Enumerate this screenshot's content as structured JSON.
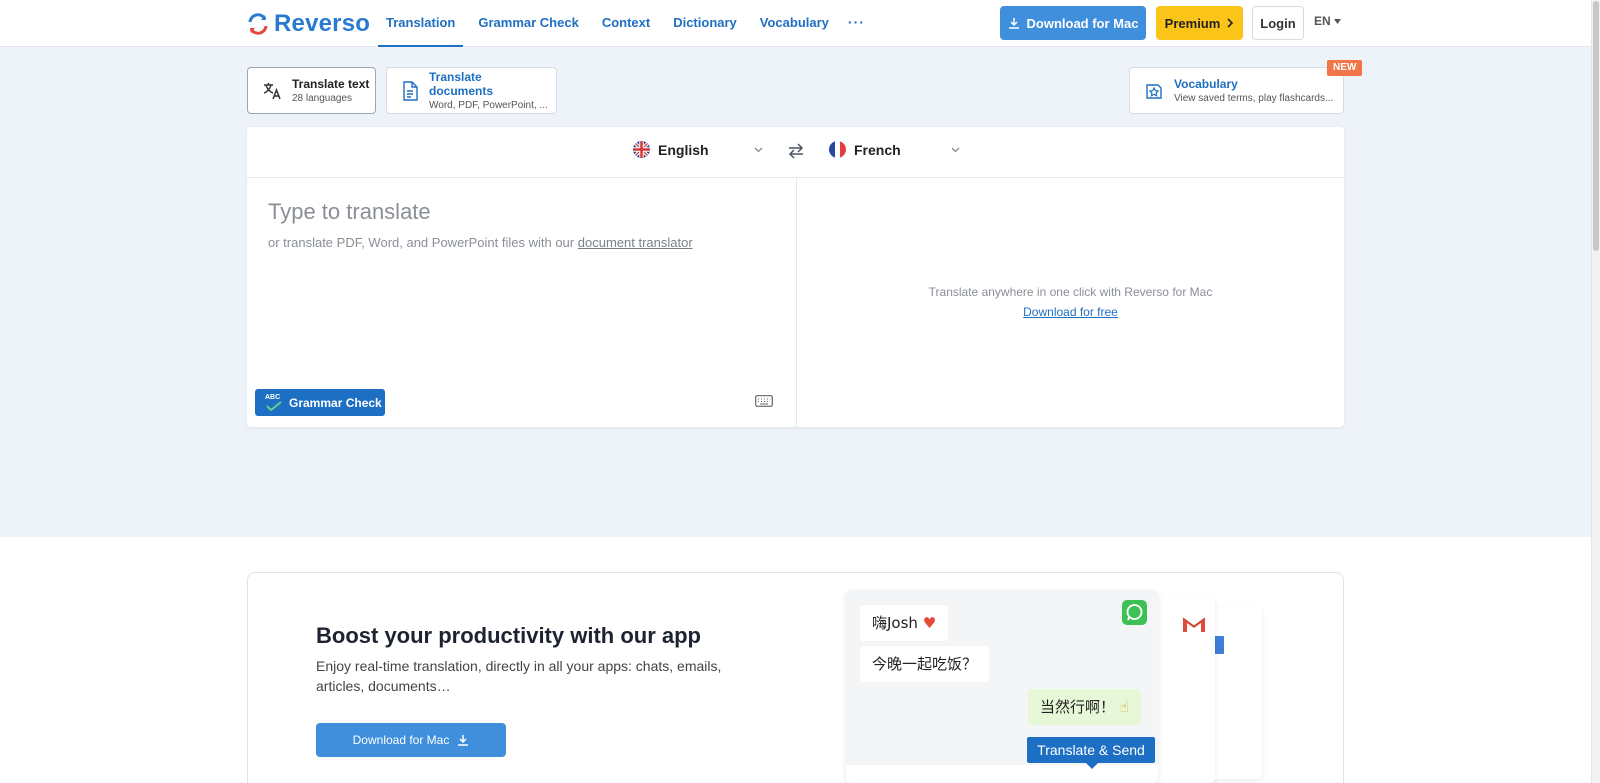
{
  "header": {
    "logo_text": "Reverso",
    "nav": [
      {
        "label": "Translation"
      },
      {
        "label": "Grammar Check"
      },
      {
        "label": "Context"
      },
      {
        "label": "Dictionary"
      },
      {
        "label": "Vocabulary"
      }
    ],
    "more_label": "···",
    "download_label": "Download for Mac",
    "premium_label": "Premium",
    "login_label": "Login",
    "lang_label": "EN"
  },
  "modes": {
    "text": {
      "title": "Translate text",
      "subtitle": "28 languages"
    },
    "docs": {
      "title": "Translate documents",
      "subtitle": "Word, PDF, PowerPoint, ..."
    },
    "vocab": {
      "title": "Vocabulary",
      "subtitle": "View saved terms, play flashcards...",
      "badge": "NEW"
    }
  },
  "translator": {
    "source_lang": "English",
    "target_lang": "French",
    "placeholder": "Type to translate",
    "hint_prefix": "or translate PDF, Word, and PowerPoint files with our",
    "hint_link": "document translator",
    "grammar_check_label": "Grammar Check",
    "abc_label": "ABC",
    "promo_text": "Translate anywhere in one click with Reverso for Mac",
    "promo_link": "Download for free"
  },
  "app_promo": {
    "heading": "Boost your productivity with our app",
    "description": "Enjoy real-time translation, directly in all your apps: chats, emails, articles, documents…",
    "download_label": "Download for Mac",
    "chat": {
      "msg1": "嗨Josh",
      "msg2": "今晚一起吃饭？",
      "msg3": "当然行啊！",
      "translate_send": "Translate & Send"
    }
  },
  "colors": {
    "brand_blue": "#1f6fc2",
    "download_blue": "#3f8fdc",
    "premium_yellow": "#fbc419",
    "hero_bg": "#eef3f9",
    "new_badge": "#f0764a"
  }
}
